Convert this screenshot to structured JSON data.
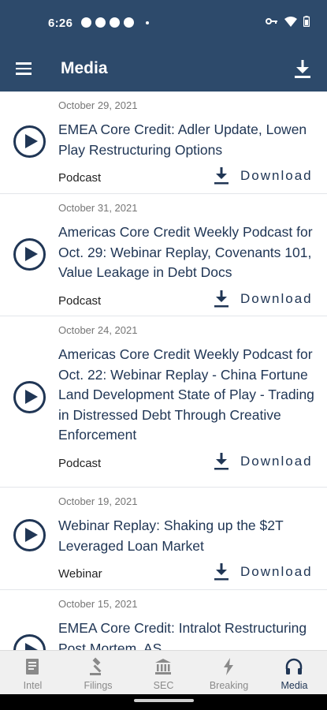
{
  "status_bar": {
    "time": "6:26"
  },
  "app_bar": {
    "title": "Media"
  },
  "items": [
    {
      "date": "October 29, 2021",
      "title": "EMEA Core Credit: Adler Update, Lowen Play Restructuring Options",
      "type": "Podcast",
      "download_label": "Download"
    },
    {
      "date": "October 31, 2021",
      "title": "Americas Core Credit Weekly Podcast for Oct. 29: Webinar Replay, Covenants 101, Value Leakage in Debt Docs",
      "type": "Podcast",
      "download_label": "Download"
    },
    {
      "date": "October 24, 2021",
      "title": "Americas Core Credit Weekly Podcast for Oct. 22: Webinar Replay - China Fortune Land Development State of Play - Trading in Distressed Debt Through Creative Enforcement",
      "type": "Podcast",
      "download_label": "Download"
    },
    {
      "date": "October 19, 2021",
      "title": "Webinar Replay: Shaking up the $2T Leveraged Loan Market",
      "type": "Webinar",
      "download_label": "Download"
    },
    {
      "date": "October 15, 2021",
      "title": "EMEA Core Credit: Intralot Restructuring Post Mortem, AS",
      "type": "",
      "download_label": ""
    }
  ],
  "bottom_nav": [
    {
      "label": "Intel",
      "icon": "document-icon",
      "active": false
    },
    {
      "label": "Filings",
      "icon": "gavel-icon",
      "active": false
    },
    {
      "label": "SEC",
      "icon": "bank-icon",
      "active": false
    },
    {
      "label": "Breaking",
      "icon": "lightning-icon",
      "active": false
    },
    {
      "label": "Media",
      "icon": "headphones-icon",
      "active": true
    }
  ],
  "colors": {
    "header": "#2d4a6b",
    "accent": "#203655",
    "muted": "#767676"
  }
}
